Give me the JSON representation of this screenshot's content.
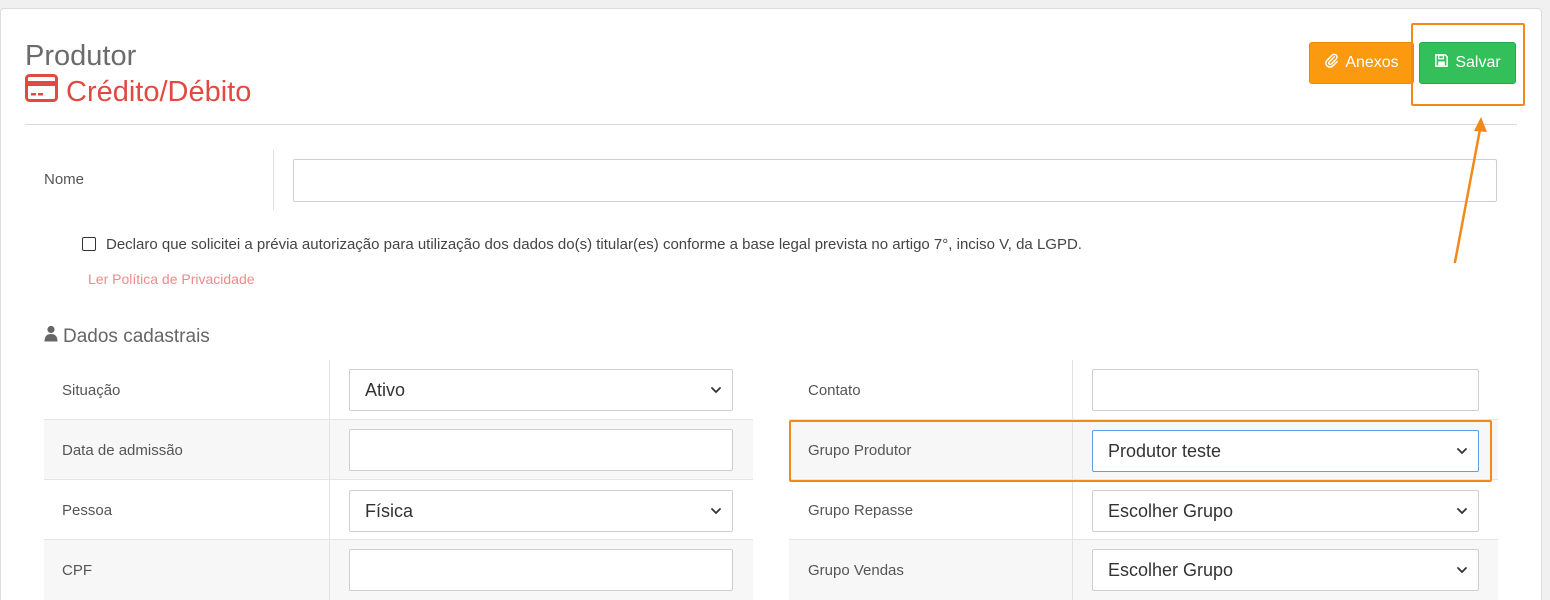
{
  "header": {
    "title": "Produtor",
    "subtitle": "Crédito/Débito",
    "subtitle_color": "#e04a40",
    "icon": "credit-card-icon"
  },
  "toolbar": {
    "anexos_label": "Anexos",
    "anexos_icon": "paperclip-icon",
    "anexos_color": "#fb9a0f",
    "salvar_label": "Salvar",
    "salvar_icon": "floppy-disk-icon",
    "salvar_color": "#33c05a"
  },
  "form": {
    "nome_label": "Nome",
    "nome_value": "",
    "consent_text": "Declaro que solicitei a prévia autorização para utilização dos dados do(s) titular(es) conforme a base legal prevista no artigo 7°, inciso V, da LGPD.",
    "consent_checked": false,
    "privacy_link": "Ler Política de Privacidade"
  },
  "section": {
    "title": "Dados cadastrais",
    "icon": "user-icon"
  },
  "left_fields": [
    {
      "label": "Situação",
      "type": "select",
      "value": "Ativo"
    },
    {
      "label": "Data de admissão",
      "type": "input",
      "value": ""
    },
    {
      "label": "Pessoa",
      "type": "select",
      "value": "Física"
    },
    {
      "label": "CPF",
      "type": "input",
      "value": ""
    }
  ],
  "right_fields": [
    {
      "label": "Contato",
      "type": "input",
      "value": ""
    },
    {
      "label": "Grupo Produtor",
      "type": "select",
      "value": "Produtor teste"
    },
    {
      "label": "Grupo Repasse",
      "type": "select",
      "value": "Escolher Grupo"
    },
    {
      "label": "Grupo Vendas",
      "type": "select",
      "value": "Escolher Grupo"
    }
  ],
  "annotations": {
    "highlight_color": "#f18a1b"
  }
}
